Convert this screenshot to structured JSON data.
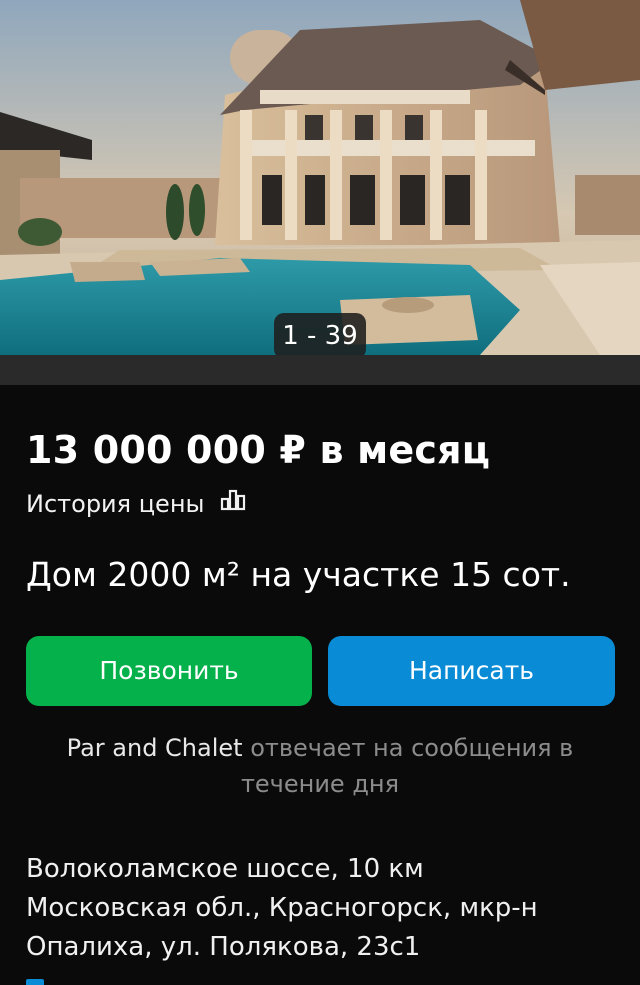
{
  "gallery": {
    "counter": "1 - 39",
    "image_subject": "house-photo"
  },
  "listing": {
    "price": "13 000 000 ₽ в месяц",
    "price_history_label": "История цены",
    "title": "Дом 2000 м² на участке 15 сот."
  },
  "actions": {
    "call_label": "Позвонить",
    "write_label": "Написать"
  },
  "seller": {
    "name": "Par and Chalet",
    "response_text": "отвечает на сообщения в течение дня"
  },
  "address": {
    "highway": "Волоколамское шоссе, 10 км",
    "line2": "Московская обл., Красногорск, мкр-н",
    "line3": "Опалиха, ул. Полякова, 23с1"
  },
  "colors": {
    "background": "#0a0a0a",
    "call_button": "#04b14a",
    "write_button": "#0a8bd6",
    "muted_text": "#8c8c8c"
  },
  "icons": [
    "bar-chart-icon"
  ]
}
